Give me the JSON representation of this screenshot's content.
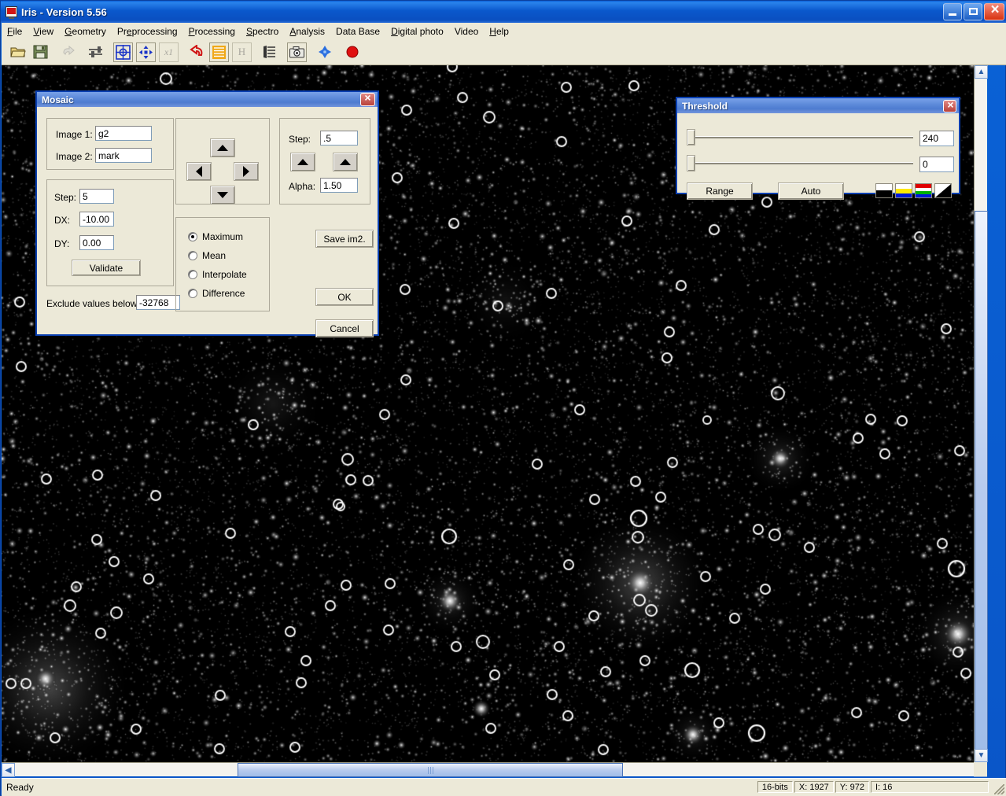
{
  "window": {
    "title": "Iris - Version 5.56",
    "icon": "monitor-icon",
    "min_label": "",
    "max_label": "",
    "close_label": ""
  },
  "menu": {
    "items": [
      {
        "label": "File",
        "accel": "F"
      },
      {
        "label": "View",
        "accel": "V"
      },
      {
        "label": "Geometry",
        "accel": "G"
      },
      {
        "label": "Preprocessing",
        "accel": "e"
      },
      {
        "label": "Processing",
        "accel": "P"
      },
      {
        "label": "Spectro",
        "accel": "S"
      },
      {
        "label": "Analysis",
        "accel": "A"
      },
      {
        "label": "Data Base",
        "accel": ""
      },
      {
        "label": "Digital photo",
        "accel": "D"
      },
      {
        "label": "Video",
        "accel": ""
      },
      {
        "label": "Help",
        "accel": "H"
      }
    ]
  },
  "toolbar": {
    "buttons": [
      {
        "name": "open-file-icon",
        "tip": "Open"
      },
      {
        "name": "save-file-icon",
        "tip": "Save"
      },
      {
        "name": "undo-icon",
        "tip": "Undo",
        "disabled": true
      },
      {
        "name": "sliders-icon",
        "tip": "Threshold"
      },
      {
        "name": "crosshair-target-icon",
        "tip": "Center"
      },
      {
        "name": "move-arrows-icon",
        "tip": "Pan"
      },
      {
        "name": "x1-zoom-icon",
        "tip": "Zoom x1",
        "disabled": true
      },
      {
        "name": "red-undo-arrow-icon",
        "tip": "Reset"
      },
      {
        "name": "orange-lines-icon",
        "tip": "Statistics"
      },
      {
        "name": "histogram-h-icon",
        "tip": "Histogram",
        "disabled": true
      },
      {
        "name": "list-lines-icon",
        "tip": "Command"
      },
      {
        "name": "camera-icon",
        "tip": "Capture"
      },
      {
        "name": "blue-diamond-icon",
        "tip": "Stars"
      },
      {
        "name": "red-circle-icon",
        "tip": "Record"
      }
    ]
  },
  "mosaic_dialog": {
    "title": "Mosaic",
    "close_label": "",
    "image1_label": "Image 1:",
    "image1_value": "g2",
    "image2_label": "Image 2:",
    "image2_value": "mark",
    "step_label": "Step:",
    "step_value": "5",
    "dx_label": "DX:",
    "dx_value": "-10.00",
    "dy_label": "DY:",
    "dy_value": "0.00",
    "validate_label": "Validate",
    "exclude_label": "Exclude values below:",
    "exclude_value": "-32768",
    "pad": {
      "up": "up-arrow-icon",
      "down": "down-arrow-icon",
      "left": "left-arrow-icon",
      "right": "right-arrow-icon"
    },
    "alpha_step_label": "Step:",
    "alpha_step_value": ".5",
    "alpha_label": "Alpha:",
    "alpha_value": "1.50",
    "modes": [
      {
        "label": "Maximum",
        "selected": true
      },
      {
        "label": "Mean",
        "selected": false
      },
      {
        "label": "Interpolate",
        "selected": false
      },
      {
        "label": "Difference",
        "selected": false
      }
    ],
    "save_label": "Save im2.",
    "ok_label": "OK",
    "cancel_label": "Cancel"
  },
  "threshold_dialog": {
    "title": "Threshold",
    "close_label": "",
    "high_value": "240",
    "low_value": "0",
    "high_slider_pos": 0,
    "low_slider_pos": 0,
    "range_label": "Range",
    "auto_label": "Auto",
    "mode_icons": [
      {
        "name": "bw-mode-icon"
      },
      {
        "name": "yellow-blue-mode-icon"
      },
      {
        "name": "rgb-mode-icon"
      },
      {
        "name": "gradient-mode-icon"
      }
    ]
  },
  "statusbar": {
    "message": "Ready",
    "bit_depth": "16-bits",
    "x": "X: 1927",
    "y": "Y: 972",
    "intensity": "I: 16"
  },
  "colors": {
    "title_blue": "#0a56c8",
    "dialog_face": "#ece9d8",
    "dialog_border": "#0a3fb0",
    "accent_red": "#d01515",
    "marker_white": "#ffffff"
  },
  "image_view": {
    "description": "astronomical star field, grayscale, with circular detection markers"
  }
}
